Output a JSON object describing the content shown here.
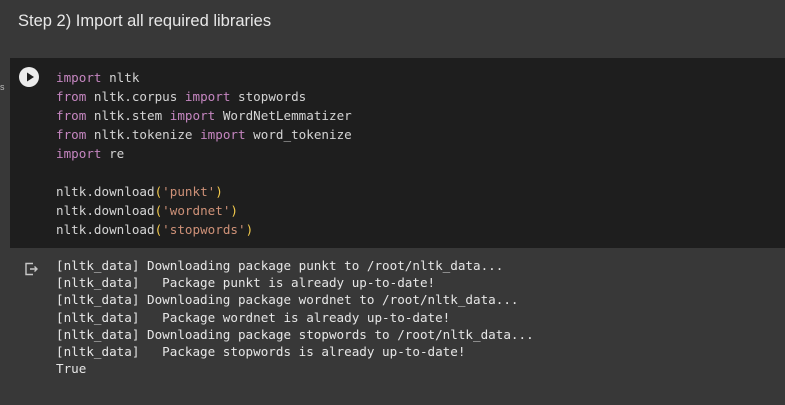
{
  "heading": "Step 2) Import all required libraries",
  "exec_marker": "s",
  "run_button": {
    "icon": "play-icon"
  },
  "code_lines": [
    [
      {
        "t": "import",
        "c": "kw"
      },
      {
        "t": " nltk",
        "c": ""
      }
    ],
    [
      {
        "t": "from",
        "c": "kw"
      },
      {
        "t": " nltk.corpus ",
        "c": ""
      },
      {
        "t": "import",
        "c": "kw"
      },
      {
        "t": " stopwords",
        "c": ""
      }
    ],
    [
      {
        "t": "from",
        "c": "kw"
      },
      {
        "t": " nltk.stem ",
        "c": ""
      },
      {
        "t": "import",
        "c": "kw"
      },
      {
        "t": " WordNetLemmatizer",
        "c": ""
      }
    ],
    [
      {
        "t": "from",
        "c": "kw"
      },
      {
        "t": " nltk.tokenize ",
        "c": ""
      },
      {
        "t": "import",
        "c": "kw"
      },
      {
        "t": " word_tokenize",
        "c": ""
      }
    ],
    [
      {
        "t": "import",
        "c": "kw"
      },
      {
        "t": " re",
        "c": ""
      }
    ],
    [],
    [
      {
        "t": "nltk.download",
        "c": ""
      },
      {
        "t": "(",
        "c": "paren"
      },
      {
        "t": "'punkt'",
        "c": "str"
      },
      {
        "t": ")",
        "c": "paren"
      }
    ],
    [
      {
        "t": "nltk.download",
        "c": ""
      },
      {
        "t": "(",
        "c": "paren"
      },
      {
        "t": "'wordnet'",
        "c": "str"
      },
      {
        "t": ")",
        "c": "paren"
      }
    ],
    [
      {
        "t": "nltk.download",
        "c": ""
      },
      {
        "t": "(",
        "c": "paren"
      },
      {
        "t": "'stopwords'",
        "c": "str"
      },
      {
        "t": ")",
        "c": "paren"
      }
    ]
  ],
  "output_icon": "output-redirect-icon",
  "output_lines": [
    "[nltk_data] Downloading package punkt to /root/nltk_data...",
    "[nltk_data]   Package punkt is already up-to-date!",
    "[nltk_data] Downloading package wordnet to /root/nltk_data...",
    "[nltk_data]   Package wordnet is already up-to-date!",
    "[nltk_data] Downloading package stopwords to /root/nltk_data...",
    "[nltk_data]   Package stopwords is already up-to-date!",
    "True"
  ],
  "colors": {
    "page_bg": "#383838",
    "cell_bg": "#1e1e1e",
    "keyword": "#c586c0",
    "string": "#ce9178",
    "paren": "#f2c94c",
    "code_text": "#d4d4d4"
  }
}
